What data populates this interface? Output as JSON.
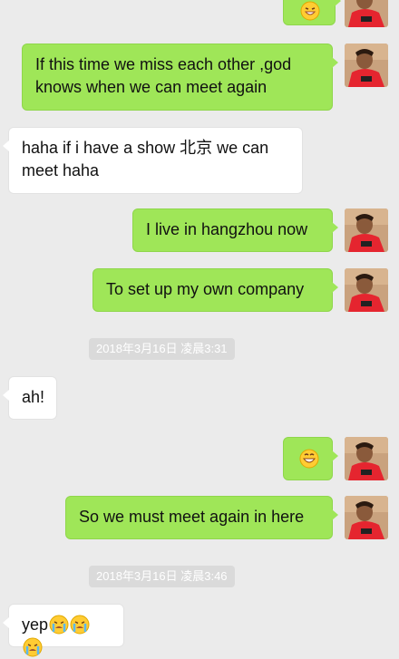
{
  "messages": [
    {
      "side": "sent",
      "type": "emoji",
      "emoji": "grin-sweat-emoji"
    },
    {
      "side": "sent",
      "text": "If this time we miss each other ,god knows when we can meet again"
    },
    {
      "side": "recv",
      "text": "haha if i have a show 北京 we can meet haha"
    },
    {
      "side": "sent",
      "text": "I live in hangzhou now"
    },
    {
      "side": "sent",
      "text": "To set up my own company"
    },
    {
      "side": "time",
      "text": "2018年3月16日 凌晨3:31"
    },
    {
      "side": "recv",
      "text": "ah!"
    },
    {
      "side": "sent",
      "type": "emoji",
      "emoji": "grinning-face-emoji"
    },
    {
      "side": "sent",
      "text": "So we must meet again in here"
    },
    {
      "side": "time",
      "text": "2018年3月16日 凌晨3:46"
    },
    {
      "side": "recv",
      "text": "yep",
      "emojis": [
        "crying-face-emoji",
        "crying-face-emoji",
        "crying-face-emoji"
      ]
    }
  ],
  "colors": {
    "background": "#ebebeb",
    "sent_bubble": "#9fe658",
    "received_bubble": "#ffffff",
    "timestamp_bg": "#dadada",
    "avatar_shirt": "#e5252f"
  }
}
